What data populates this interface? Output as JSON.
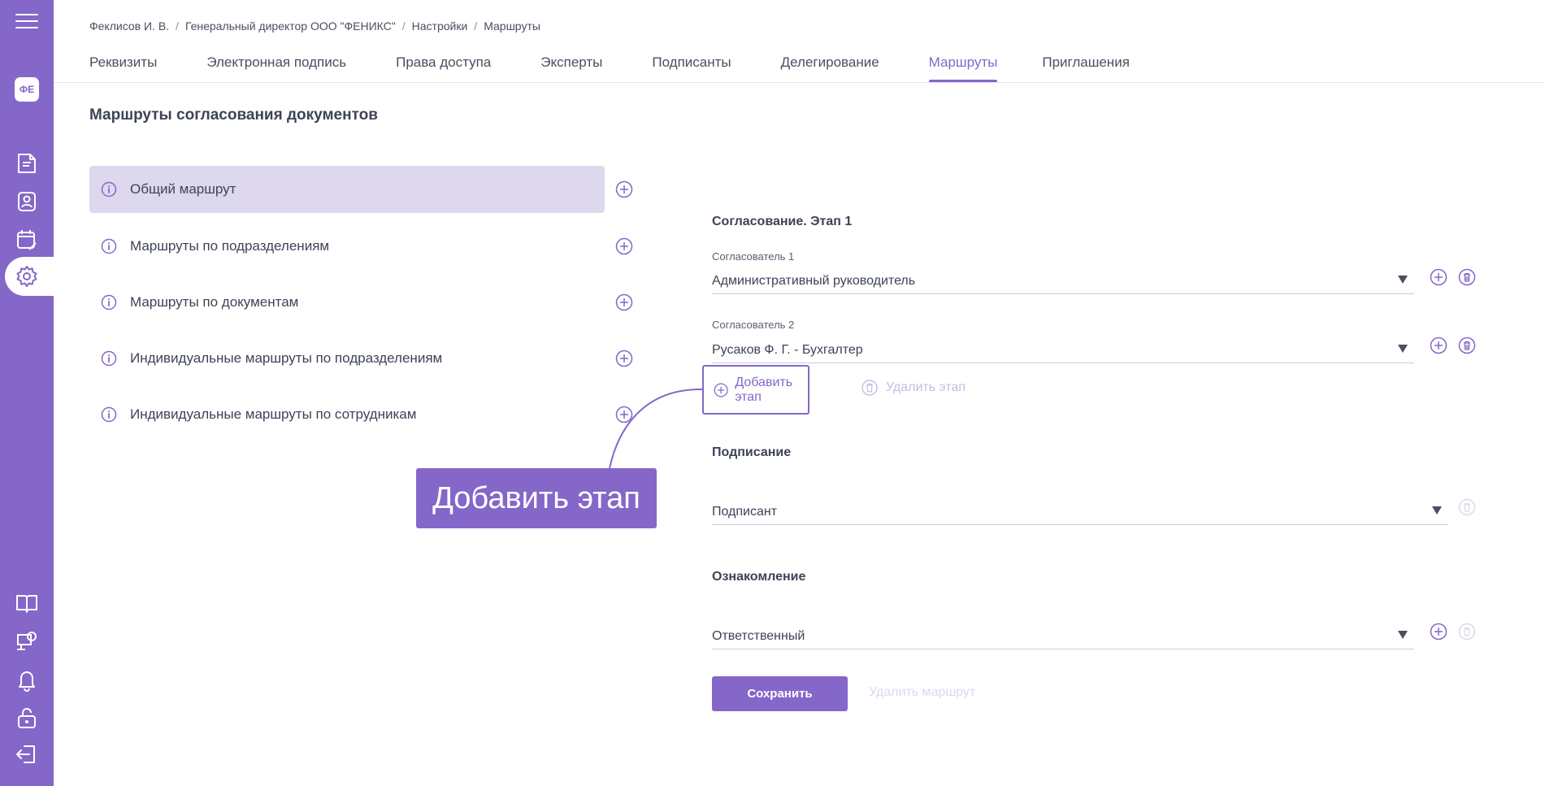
{
  "colors": {
    "accent": "#8467c8",
    "accent_light": "#ded8ee",
    "text": "#3d4356"
  },
  "sidebar": {
    "avatar_initials": "ФЕ",
    "icons": [
      "menu-icon",
      "document-icon",
      "contact-icon",
      "calendar-edit-icon",
      "gear-icon",
      "book-icon",
      "support-icon",
      "bell-icon",
      "unlock-icon",
      "logout-icon"
    ],
    "active": "gear-icon"
  },
  "breadcrumb": [
    "Феклисов И. В.",
    "Генеральный директор ООО \"ФЕНИКС\"",
    "Настройки",
    "Маршруты"
  ],
  "tabs": [
    {
      "label": "Реквизиты"
    },
    {
      "label": "Электронная подпись"
    },
    {
      "label": "Права доступа"
    },
    {
      "label": "Эксперты"
    },
    {
      "label": "Подписанты"
    },
    {
      "label": "Делегирование"
    },
    {
      "label": "Маршруты",
      "active": true
    },
    {
      "label": "Приглашения"
    }
  ],
  "page_title": "Маршруты согласования документов",
  "routes": [
    {
      "label": "Общий маршрут",
      "active": true
    },
    {
      "label": "Маршруты по подразделениям"
    },
    {
      "label": "Маршруты по документам"
    },
    {
      "label": "Индивидуальные маршруты по подразделениям"
    },
    {
      "label": "Индивидуальные маршруты по сотрудникам"
    }
  ],
  "approval": {
    "title": "Согласование. Этап 1",
    "approvers": [
      {
        "label": "Согласователь 1",
        "value": "Административный руководитель"
      },
      {
        "label": "Согласователь 2",
        "value": "Русаков Ф. Г. - Бухгалтер"
      }
    ],
    "add_stage_label": "Добавить этап",
    "delete_stage_label": "Удалить этап"
  },
  "signing": {
    "title": "Подписание",
    "value": "Подписант"
  },
  "familiarization": {
    "title": "Ознакомление",
    "value": "Ответственный"
  },
  "save_label": "Сохранить",
  "delete_route_label": "Удалить маршрут",
  "callout_text": "Добавить этап"
}
